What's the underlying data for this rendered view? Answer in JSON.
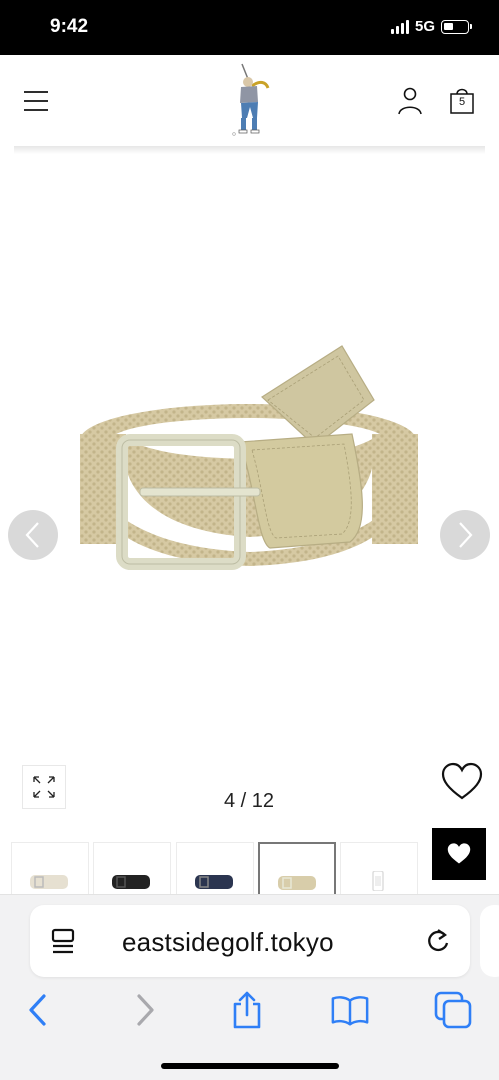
{
  "status_bar": {
    "time": "9:42",
    "network": "5G",
    "icons": [
      "signal-icon",
      "battery-icon"
    ]
  },
  "header": {
    "menu_icon": "hamburger-icon",
    "logo_icon": "golfer-logo-icon",
    "account_icon": "person-icon",
    "cart_icon": "shopping-bag-icon",
    "cart_count": "5"
  },
  "gallery": {
    "image_icon": "woven-belt-image",
    "prev_icon": "chevron-left-icon",
    "next_icon": "chevron-right-icon",
    "expand_icon": "expand-arrows-icon",
    "counter_current": "4",
    "counter_separator": "/",
    "counter_total": "12",
    "wishlist_icon": "heart-outline-icon",
    "floating_fav_icon": "heart-filled-icon",
    "thumbnails": [
      {
        "color": "#e6e0d1",
        "active": false
      },
      {
        "color": "#222222",
        "active": false
      },
      {
        "color": "#2b3550",
        "active": false
      },
      {
        "color": "#d8cdaa",
        "active": true
      },
      {
        "color": "#e8e4dc",
        "active": false
      }
    ]
  },
  "safari": {
    "reader_icon": "page-menu-icon",
    "url": "eastsidegolf.tokyo",
    "reload_icon": "reload-icon",
    "toolbar_icons": [
      "back-icon",
      "forward-icon",
      "share-icon",
      "bookmarks-icon",
      "tabs-icon"
    ],
    "accent": "#2f7ff6"
  }
}
